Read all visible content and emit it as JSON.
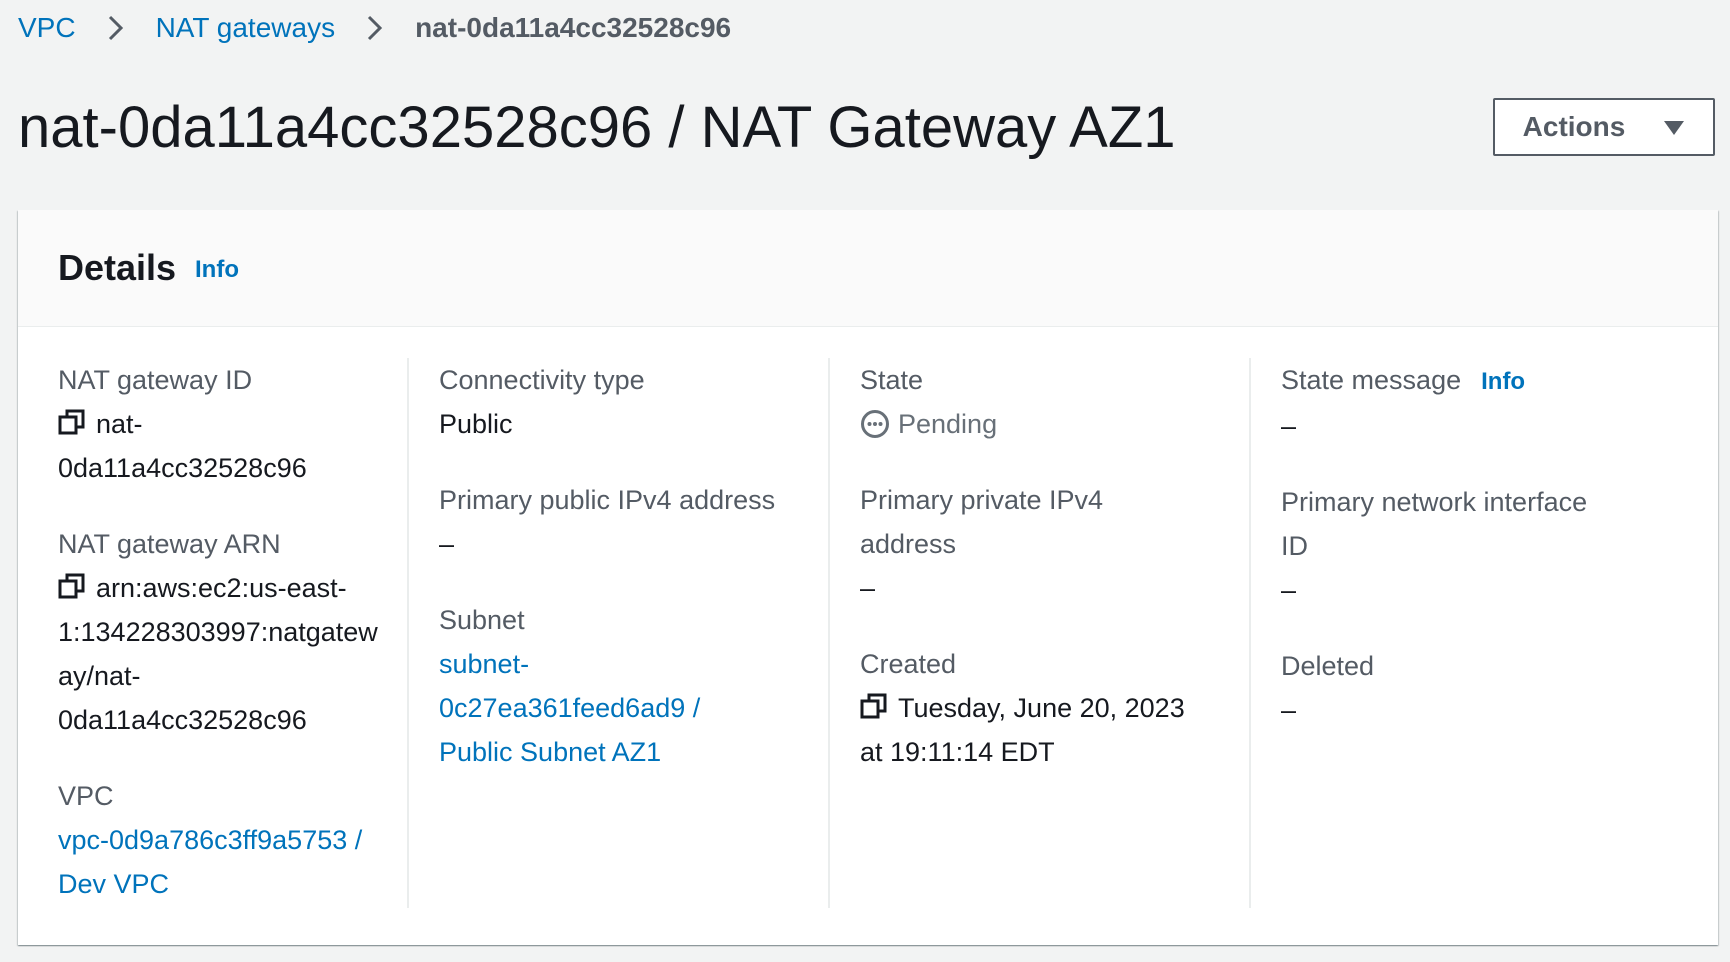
{
  "breadcrumb": {
    "items": [
      "VPC",
      "NAT gateways"
    ],
    "current": "nat-0da11a4cc32528c96"
  },
  "page": {
    "title": "nat-0da11a4cc32528c96 / NAT Gateway AZ1"
  },
  "actions": {
    "label": "Actions",
    "icon": "caret-down-icon"
  },
  "details": {
    "title": "Details",
    "info": "Info",
    "fields": {
      "nat_gateway_id": {
        "label": "NAT gateway ID",
        "value_line1": "nat-",
        "value_line2": "0da11a4cc32528c96"
      },
      "nat_gateway_arn": {
        "label": "NAT gateway ARN",
        "value_line1": "arn:aws:ec2:us-east-",
        "value_line2": "1:134228303997:natgatew",
        "value_line3": "ay/nat-",
        "value_line4": "0da11a4cc32528c96"
      },
      "vpc": {
        "label": "VPC",
        "value_line1": "vpc-0d9a786c3ff9a5753 /",
        "value_line2": "Dev VPC"
      },
      "connectivity_type": {
        "label": "Connectivity type",
        "value": "Public"
      },
      "primary_public_ipv4": {
        "label": "Primary public IPv4 address",
        "value": "–"
      },
      "subnet": {
        "label": "Subnet",
        "value_line1": "subnet-",
        "value_line2": "0c27ea361feed6ad9 /",
        "value_line3": "Public Subnet AZ1"
      },
      "state": {
        "label": "State",
        "value": "Pending"
      },
      "primary_private_ipv4": {
        "label_line1": "Primary private IPv4",
        "label_line2": "address",
        "value": "–"
      },
      "created": {
        "label": "Created",
        "value_line1": "Tuesday, June 20, 2023",
        "value_line2": "at 19:11:14 EDT"
      },
      "state_message": {
        "label": "State message",
        "info": "Info",
        "value": "–"
      },
      "primary_network_interface": {
        "label_line1": "Primary network interface",
        "label_line2": "ID",
        "value": "–"
      },
      "deleted": {
        "label": "Deleted",
        "value": "–"
      }
    }
  },
  "colors": {
    "link": "#0073bb",
    "label": "#545b64",
    "text": "#16191f",
    "pending": "#687078",
    "background": "#f2f3f3"
  }
}
